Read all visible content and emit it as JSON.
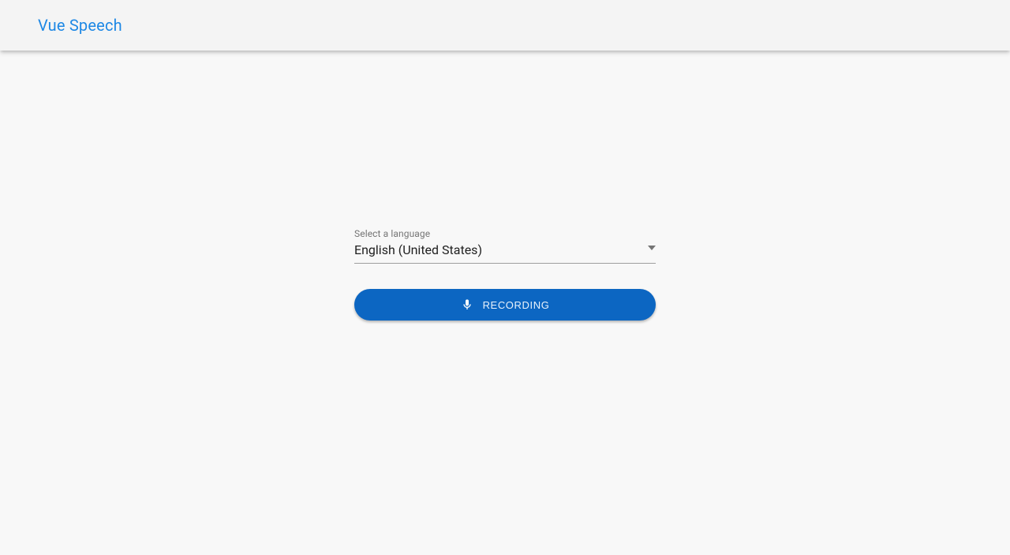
{
  "header": {
    "title": "Vue Speech"
  },
  "form": {
    "language_label": "Select a language",
    "language_value": "English (United States)"
  },
  "actions": {
    "record_label": "RECORDING"
  }
}
